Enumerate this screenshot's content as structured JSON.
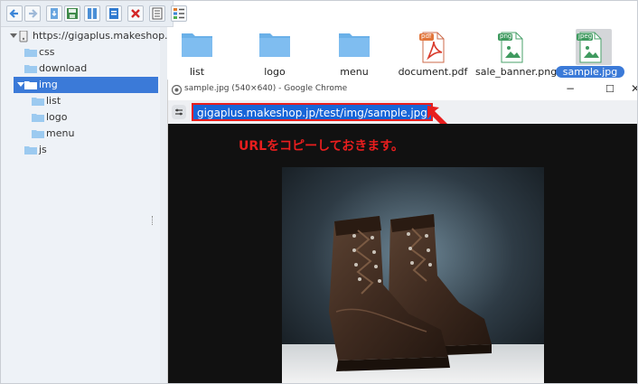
{
  "tree": {
    "root_label": "https://gigaplus.makeshop.jp",
    "items": [
      {
        "label": "css"
      },
      {
        "label": "download"
      },
      {
        "label": "img"
      },
      {
        "label": "list"
      },
      {
        "label": "logo"
      },
      {
        "label": "menu"
      },
      {
        "label": "js"
      }
    ]
  },
  "files": [
    {
      "name": "list",
      "icon": "folder-icon"
    },
    {
      "name": "logo",
      "icon": "folder-icon"
    },
    {
      "name": "menu",
      "icon": "folder-icon"
    },
    {
      "name": "document.pdf",
      "icon": "pdf-file-icon",
      "badge": "pdf"
    },
    {
      "name": "sale_banner.png",
      "icon": "png-file-icon",
      "badge": "png"
    },
    {
      "name": "sample.jpg",
      "icon": "jpeg-file-icon",
      "badge": "jpeg"
    }
  ],
  "browser": {
    "title": "sample.jpg (540×640) - Google Chrome",
    "url": "gigaplus.makeshop.jp/test/img/sample.jpg",
    "controls": {
      "minimize": "−",
      "maximize": "☐",
      "close": "✕"
    }
  },
  "annotation": {
    "text": "URLをコピーしておきます。",
    "color": "#e81e1e"
  },
  "colors": {
    "selection": "#3b7ad8",
    "folder": "#6ab0e8",
    "url_highlight": "#1765d8",
    "annotation_red": "#e81e1e"
  }
}
